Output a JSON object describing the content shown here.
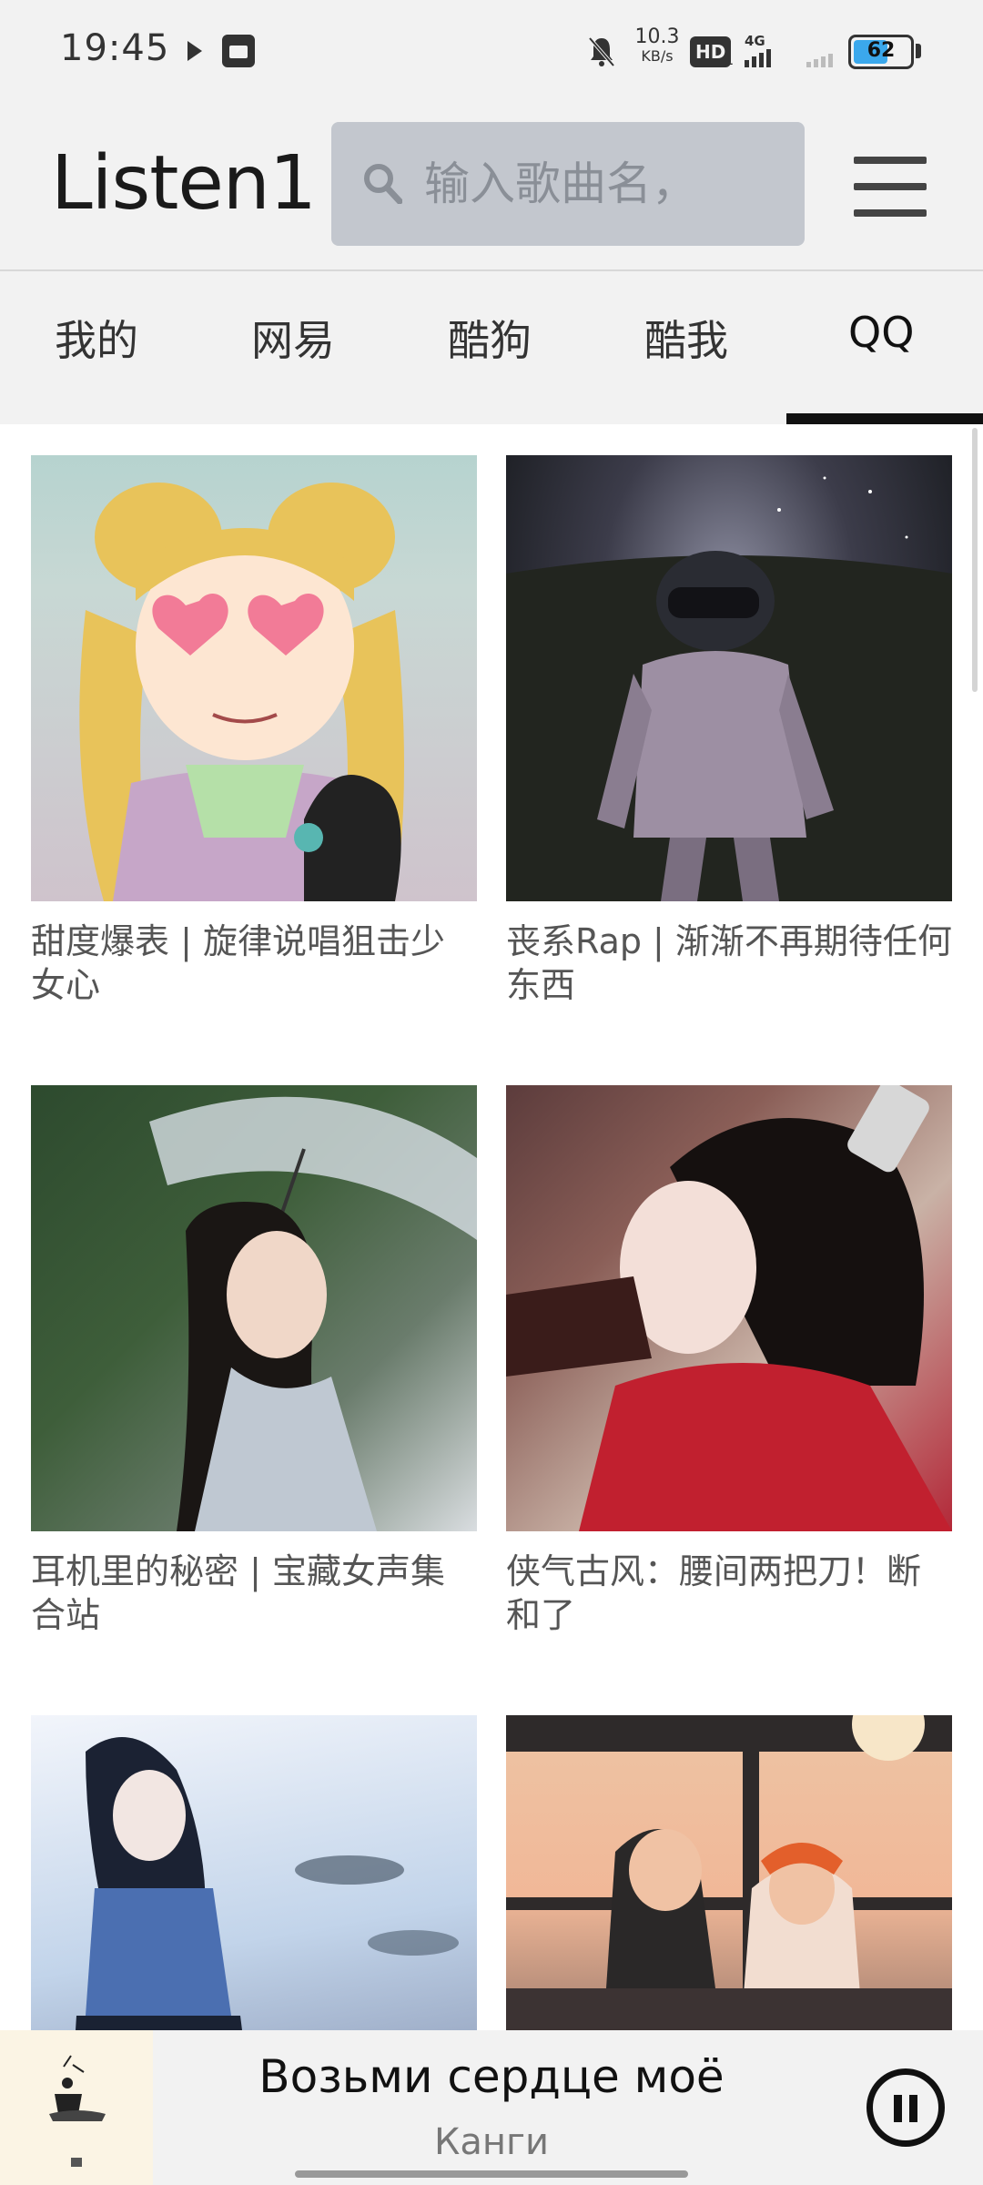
{
  "status_bar": {
    "time": "19:45",
    "net_speed": "10.3",
    "net_speed_unit": "KB/s",
    "hd_label": "HD",
    "hd_sub": "1",
    "network_label": "4G",
    "battery_level": "62",
    "battery_fraction": 0.62,
    "battery_color": "#3ba8ec",
    "icons": [
      "play-icon",
      "notification-box-icon",
      "mute-bell-icon",
      "signal-icon",
      "battery-icon"
    ]
  },
  "header": {
    "app_title": "Listen1",
    "search_placeholder": "输入歌曲名，",
    "search_value": ""
  },
  "tabs": [
    {
      "label": "我的",
      "active": false
    },
    {
      "label": "网易",
      "active": false
    },
    {
      "label": "酷狗",
      "active": false
    },
    {
      "label": "酷我",
      "active": false
    },
    {
      "label": "QQ",
      "active": true
    }
  ],
  "playlists": [
    {
      "title": "甜度爆表 | 旋律说唱狙击少女心",
      "cover": "anime-girl-heart-glasses"
    },
    {
      "title": "丧系Rap | 渐渐不再期待任何东西",
      "cover": "astronaut-night-sky"
    },
    {
      "title": "耳机里的秘密 | 宝藏女声集合站",
      "cover": "girl-with-umbrella"
    },
    {
      "title": "侠气古风：腰间两把刀！断和了",
      "cover": "woman-red-dress-drinking"
    },
    {
      "title": "",
      "cover": "anime-girl-sky"
    },
    {
      "title": "",
      "cover": "couple-on-bus"
    }
  ],
  "player": {
    "title": "Возьми сердце моё",
    "artist": "Канги",
    "state": "playing"
  }
}
